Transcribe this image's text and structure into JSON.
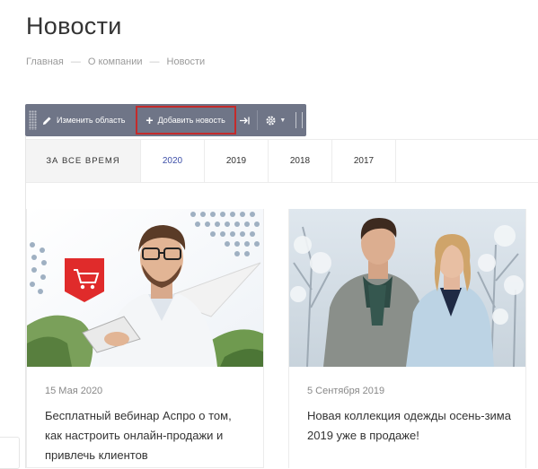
{
  "page": {
    "title": "Новости"
  },
  "breadcrumb": [
    "Главная",
    "О компании",
    "Новости"
  ],
  "toolbar": {
    "edit_label": "Изменить область",
    "add_label": "Добавить новость"
  },
  "tabs": {
    "all_label": "ЗА ВСЕ ВРЕМЯ",
    "years": [
      "2020",
      "2019",
      "2018",
      "2017"
    ],
    "active": "2020"
  },
  "news": [
    {
      "date": "15 Мая 2020",
      "title": "Бесплатный вебинар Аспро о том, как настроить онлайн-продажи и привлечь клиентов"
    },
    {
      "date": "5 Сентября 2019",
      "title": "Новая коллекция одежды осень-зима 2019 уже в продаже!"
    }
  ],
  "colors": {
    "accent": "#3d4fa8",
    "toolbar": "#6f7587",
    "highlight": "#c42b2b"
  }
}
